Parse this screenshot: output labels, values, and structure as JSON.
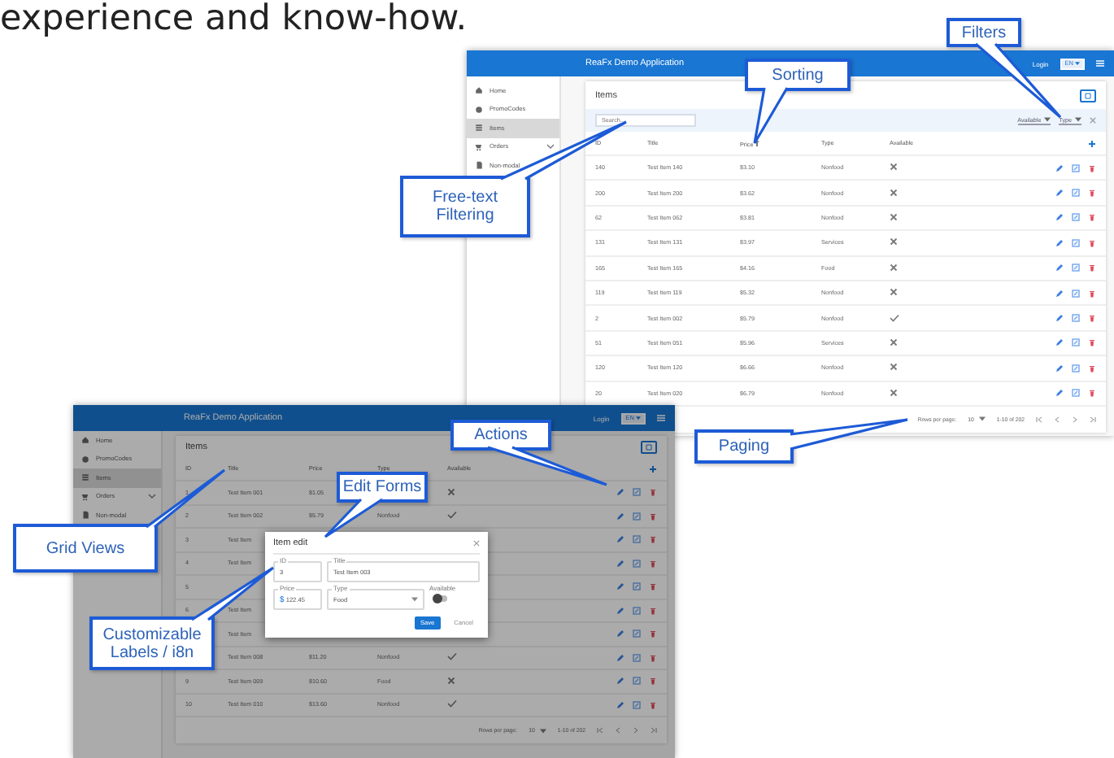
{
  "heading": "experience and know-how.",
  "screens": [
    {
      "app_title": "ReaFx Demo Application",
      "login": "Login",
      "language": "EN",
      "dimmed": false,
      "sidebar": [
        {
          "label": "Home",
          "selected": false
        },
        {
          "label": "PromoCodes",
          "selected": false
        },
        {
          "label": "Items",
          "selected": true
        },
        {
          "label": "Orders",
          "selected": false,
          "expandable": true
        },
        {
          "label": "Non-modal",
          "selected": false
        }
      ],
      "page_title": "Items",
      "search": {
        "placeholder": "Search..."
      },
      "filters": [
        "Available",
        "Type"
      ],
      "columns": [
        {
          "label": "ID",
          "sorted": false
        },
        {
          "label": "Title",
          "sorted": false
        },
        {
          "label": "Price",
          "sorted": true
        },
        {
          "label": "Type",
          "sorted": false
        },
        {
          "label": "Available",
          "sorted": false
        }
      ],
      "rows": [
        {
          "id": "140",
          "title": "Test Item 140",
          "price": "$3.10",
          "type": "Nonfood",
          "available": false
        },
        {
          "id": "200",
          "title": "Test Item 200",
          "price": "$3.62",
          "type": "Nonfood",
          "available": false
        },
        {
          "id": "62",
          "title": "Test Item 062",
          "price": "$3.81",
          "type": "Nonfood",
          "available": false
        },
        {
          "id": "131",
          "title": "Test Item 131",
          "price": "$3.97",
          "type": "Services",
          "available": false
        },
        {
          "id": "165",
          "title": "Test Item 165",
          "price": "$4.16",
          "type": "Food",
          "available": false
        },
        {
          "id": "119",
          "title": "Test Item 119",
          "price": "$5.32",
          "type": "Nonfood",
          "available": false
        },
        {
          "id": "2",
          "title": "Test Item 002",
          "price": "$5.79",
          "type": "Nonfood",
          "available": true
        },
        {
          "id": "51",
          "title": "Test Item 051",
          "price": "$5.96",
          "type": "Services",
          "available": false
        },
        {
          "id": "120",
          "title": "Test Item 120",
          "price": "$6.66",
          "type": "Nonfood",
          "available": false
        },
        {
          "id": "20",
          "title": "Test Item 020",
          "price": "$6.79",
          "type": "Nonfood",
          "available": false
        }
      ],
      "pager": {
        "label": "Rows per page:",
        "rows_per_page": "10",
        "range": "1-10 of 202"
      }
    },
    {
      "app_title": "ReaFx Demo Application",
      "login": "Login",
      "language": "EN",
      "dimmed": true,
      "sidebar": [
        {
          "label": "Home",
          "selected": false
        },
        {
          "label": "PromoCodes",
          "selected": false
        },
        {
          "label": "Items",
          "selected": true
        },
        {
          "label": "Orders",
          "selected": false,
          "expandable": true
        },
        {
          "label": "Non-modal",
          "selected": false
        }
      ],
      "page_title": "Items",
      "columns": [
        {
          "label": "ID",
          "sorted": false
        },
        {
          "label": "Title",
          "sorted": false
        },
        {
          "label": "Price",
          "sorted": false
        },
        {
          "label": "Type",
          "sorted": false
        },
        {
          "label": "Available",
          "sorted": false
        }
      ],
      "rows": [
        {
          "id": "1",
          "title": "Test Item 001",
          "price": "$1.05",
          "available": false
        },
        {
          "id": "2",
          "title": "Test Item 002",
          "price": "$5.79",
          "type": "Nonfood",
          "available": true
        },
        {
          "id": "3",
          "title": "Test Item"
        },
        {
          "id": "4",
          "title": "Test Item"
        },
        {
          "id": "5"
        },
        {
          "id": "6",
          "title": "Test Item"
        },
        {
          "title": "Test Item"
        },
        {
          "title": "Test Item 008",
          "price": "$11.20",
          "type": "Nonfood",
          "available": true
        },
        {
          "id": "9",
          "title": "Test Item 009",
          "price": "$10.60",
          "type": "Food",
          "available": false
        },
        {
          "id": "10",
          "title": "Test Item 010",
          "price": "$13.60",
          "type": "Nonfood",
          "available": true
        }
      ],
      "pager": {
        "label": "Rows per page:",
        "rows_per_page": "10",
        "range": "1-10 of 202"
      }
    }
  ],
  "dialog": {
    "title": "Item edit",
    "fields": [
      {
        "kind": "text",
        "label": "ID",
        "value": "3"
      },
      {
        "kind": "text",
        "label": "Title",
        "value": "Test Item 003"
      },
      {
        "kind": "money",
        "label": "Price",
        "prefix": "$",
        "value": "122.45"
      },
      {
        "kind": "select",
        "label": "Type",
        "value": "Food"
      },
      {
        "kind": "toggle",
        "label": "Available",
        "on": false
      }
    ],
    "buttons": [
      {
        "label": "Save",
        "primary": true
      },
      {
        "label": "Cancel",
        "primary": false
      }
    ]
  },
  "callouts": [
    {
      "text": "Filters"
    },
    {
      "text": "Sorting"
    },
    {
      "text": "Free-text Filtering"
    },
    {
      "text": "Paging"
    },
    {
      "text": "Actions"
    },
    {
      "text": "Edit Forms"
    },
    {
      "text": "Grid Views"
    },
    {
      "text": "Customizable Labels / i8n"
    }
  ]
}
